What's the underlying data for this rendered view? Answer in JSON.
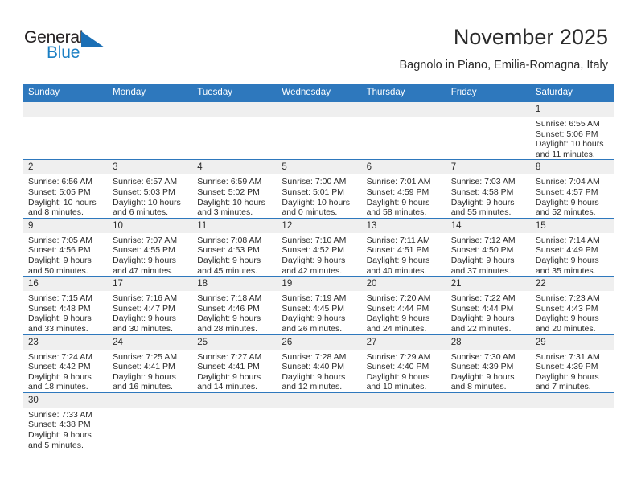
{
  "brand": {
    "name_top": "General",
    "name_bottom": "Blue",
    "flag_icon": "blue-flag-icon",
    "color_top": "#231f20",
    "color_bottom": "#1b7fc4"
  },
  "header": {
    "title": "November 2025",
    "subtitle": "Bagnolo in Piano, Emilia-Romagna, Italy"
  },
  "theme": {
    "header_blue": "#2e78bd",
    "number_band": "#efefef",
    "text": "#2b2b2b"
  },
  "calendar": {
    "weekday_headers": [
      "Sunday",
      "Monday",
      "Tuesday",
      "Wednesday",
      "Thursday",
      "Friday",
      "Saturday"
    ],
    "weeks": [
      [
        {
          "day": "",
          "sunrise": "",
          "sunset": "",
          "daylight_line1": "",
          "daylight_line2": ""
        },
        {
          "day": "",
          "sunrise": "",
          "sunset": "",
          "daylight_line1": "",
          "daylight_line2": ""
        },
        {
          "day": "",
          "sunrise": "",
          "sunset": "",
          "daylight_line1": "",
          "daylight_line2": ""
        },
        {
          "day": "",
          "sunrise": "",
          "sunset": "",
          "daylight_line1": "",
          "daylight_line2": ""
        },
        {
          "day": "",
          "sunrise": "",
          "sunset": "",
          "daylight_line1": "",
          "daylight_line2": ""
        },
        {
          "day": "",
          "sunrise": "",
          "sunset": "",
          "daylight_line1": "",
          "daylight_line2": ""
        },
        {
          "day": "1",
          "sunrise": "Sunrise: 6:55 AM",
          "sunset": "Sunset: 5:06 PM",
          "daylight_line1": "Daylight: 10 hours",
          "daylight_line2": "and 11 minutes."
        }
      ],
      [
        {
          "day": "2",
          "sunrise": "Sunrise: 6:56 AM",
          "sunset": "Sunset: 5:05 PM",
          "daylight_line1": "Daylight: 10 hours",
          "daylight_line2": "and 8 minutes."
        },
        {
          "day": "3",
          "sunrise": "Sunrise: 6:57 AM",
          "sunset": "Sunset: 5:03 PM",
          "daylight_line1": "Daylight: 10 hours",
          "daylight_line2": "and 6 minutes."
        },
        {
          "day": "4",
          "sunrise": "Sunrise: 6:59 AM",
          "sunset": "Sunset: 5:02 PM",
          "daylight_line1": "Daylight: 10 hours",
          "daylight_line2": "and 3 minutes."
        },
        {
          "day": "5",
          "sunrise": "Sunrise: 7:00 AM",
          "sunset": "Sunset: 5:01 PM",
          "daylight_line1": "Daylight: 10 hours",
          "daylight_line2": "and 0 minutes."
        },
        {
          "day": "6",
          "sunrise": "Sunrise: 7:01 AM",
          "sunset": "Sunset: 4:59 PM",
          "daylight_line1": "Daylight: 9 hours",
          "daylight_line2": "and 58 minutes."
        },
        {
          "day": "7",
          "sunrise": "Sunrise: 7:03 AM",
          "sunset": "Sunset: 4:58 PM",
          "daylight_line1": "Daylight: 9 hours",
          "daylight_line2": "and 55 minutes."
        },
        {
          "day": "8",
          "sunrise": "Sunrise: 7:04 AM",
          "sunset": "Sunset: 4:57 PM",
          "daylight_line1": "Daylight: 9 hours",
          "daylight_line2": "and 52 minutes."
        }
      ],
      [
        {
          "day": "9",
          "sunrise": "Sunrise: 7:05 AM",
          "sunset": "Sunset: 4:56 PM",
          "daylight_line1": "Daylight: 9 hours",
          "daylight_line2": "and 50 minutes."
        },
        {
          "day": "10",
          "sunrise": "Sunrise: 7:07 AM",
          "sunset": "Sunset: 4:55 PM",
          "daylight_line1": "Daylight: 9 hours",
          "daylight_line2": "and 47 minutes."
        },
        {
          "day": "11",
          "sunrise": "Sunrise: 7:08 AM",
          "sunset": "Sunset: 4:53 PM",
          "daylight_line1": "Daylight: 9 hours",
          "daylight_line2": "and 45 minutes."
        },
        {
          "day": "12",
          "sunrise": "Sunrise: 7:10 AM",
          "sunset": "Sunset: 4:52 PM",
          "daylight_line1": "Daylight: 9 hours",
          "daylight_line2": "and 42 minutes."
        },
        {
          "day": "13",
          "sunrise": "Sunrise: 7:11 AM",
          "sunset": "Sunset: 4:51 PM",
          "daylight_line1": "Daylight: 9 hours",
          "daylight_line2": "and 40 minutes."
        },
        {
          "day": "14",
          "sunrise": "Sunrise: 7:12 AM",
          "sunset": "Sunset: 4:50 PM",
          "daylight_line1": "Daylight: 9 hours",
          "daylight_line2": "and 37 minutes."
        },
        {
          "day": "15",
          "sunrise": "Sunrise: 7:14 AM",
          "sunset": "Sunset: 4:49 PM",
          "daylight_line1": "Daylight: 9 hours",
          "daylight_line2": "and 35 minutes."
        }
      ],
      [
        {
          "day": "16",
          "sunrise": "Sunrise: 7:15 AM",
          "sunset": "Sunset: 4:48 PM",
          "daylight_line1": "Daylight: 9 hours",
          "daylight_line2": "and 33 minutes."
        },
        {
          "day": "17",
          "sunrise": "Sunrise: 7:16 AM",
          "sunset": "Sunset: 4:47 PM",
          "daylight_line1": "Daylight: 9 hours",
          "daylight_line2": "and 30 minutes."
        },
        {
          "day": "18",
          "sunrise": "Sunrise: 7:18 AM",
          "sunset": "Sunset: 4:46 PM",
          "daylight_line1": "Daylight: 9 hours",
          "daylight_line2": "and 28 minutes."
        },
        {
          "day": "19",
          "sunrise": "Sunrise: 7:19 AM",
          "sunset": "Sunset: 4:45 PM",
          "daylight_line1": "Daylight: 9 hours",
          "daylight_line2": "and 26 minutes."
        },
        {
          "day": "20",
          "sunrise": "Sunrise: 7:20 AM",
          "sunset": "Sunset: 4:44 PM",
          "daylight_line1": "Daylight: 9 hours",
          "daylight_line2": "and 24 minutes."
        },
        {
          "day": "21",
          "sunrise": "Sunrise: 7:22 AM",
          "sunset": "Sunset: 4:44 PM",
          "daylight_line1": "Daylight: 9 hours",
          "daylight_line2": "and 22 minutes."
        },
        {
          "day": "22",
          "sunrise": "Sunrise: 7:23 AM",
          "sunset": "Sunset: 4:43 PM",
          "daylight_line1": "Daylight: 9 hours",
          "daylight_line2": "and 20 minutes."
        }
      ],
      [
        {
          "day": "23",
          "sunrise": "Sunrise: 7:24 AM",
          "sunset": "Sunset: 4:42 PM",
          "daylight_line1": "Daylight: 9 hours",
          "daylight_line2": "and 18 minutes."
        },
        {
          "day": "24",
          "sunrise": "Sunrise: 7:25 AM",
          "sunset": "Sunset: 4:41 PM",
          "daylight_line1": "Daylight: 9 hours",
          "daylight_line2": "and 16 minutes."
        },
        {
          "day": "25",
          "sunrise": "Sunrise: 7:27 AM",
          "sunset": "Sunset: 4:41 PM",
          "daylight_line1": "Daylight: 9 hours",
          "daylight_line2": "and 14 minutes."
        },
        {
          "day": "26",
          "sunrise": "Sunrise: 7:28 AM",
          "sunset": "Sunset: 4:40 PM",
          "daylight_line1": "Daylight: 9 hours",
          "daylight_line2": "and 12 minutes."
        },
        {
          "day": "27",
          "sunrise": "Sunrise: 7:29 AM",
          "sunset": "Sunset: 4:40 PM",
          "daylight_line1": "Daylight: 9 hours",
          "daylight_line2": "and 10 minutes."
        },
        {
          "day": "28",
          "sunrise": "Sunrise: 7:30 AM",
          "sunset": "Sunset: 4:39 PM",
          "daylight_line1": "Daylight: 9 hours",
          "daylight_line2": "and 8 minutes."
        },
        {
          "day": "29",
          "sunrise": "Sunrise: 7:31 AM",
          "sunset": "Sunset: 4:39 PM",
          "daylight_line1": "Daylight: 9 hours",
          "daylight_line2": "and 7 minutes."
        }
      ],
      [
        {
          "day": "30",
          "sunrise": "Sunrise: 7:33 AM",
          "sunset": "Sunset: 4:38 PM",
          "daylight_line1": "Daylight: 9 hours",
          "daylight_line2": "and 5 minutes."
        },
        {
          "day": "",
          "sunrise": "",
          "sunset": "",
          "daylight_line1": "",
          "daylight_line2": ""
        },
        {
          "day": "",
          "sunrise": "",
          "sunset": "",
          "daylight_line1": "",
          "daylight_line2": ""
        },
        {
          "day": "",
          "sunrise": "",
          "sunset": "",
          "daylight_line1": "",
          "daylight_line2": ""
        },
        {
          "day": "",
          "sunrise": "",
          "sunset": "",
          "daylight_line1": "",
          "daylight_line2": ""
        },
        {
          "day": "",
          "sunrise": "",
          "sunset": "",
          "daylight_line1": "",
          "daylight_line2": ""
        },
        {
          "day": "",
          "sunrise": "",
          "sunset": "",
          "daylight_line1": "",
          "daylight_line2": ""
        }
      ]
    ]
  }
}
